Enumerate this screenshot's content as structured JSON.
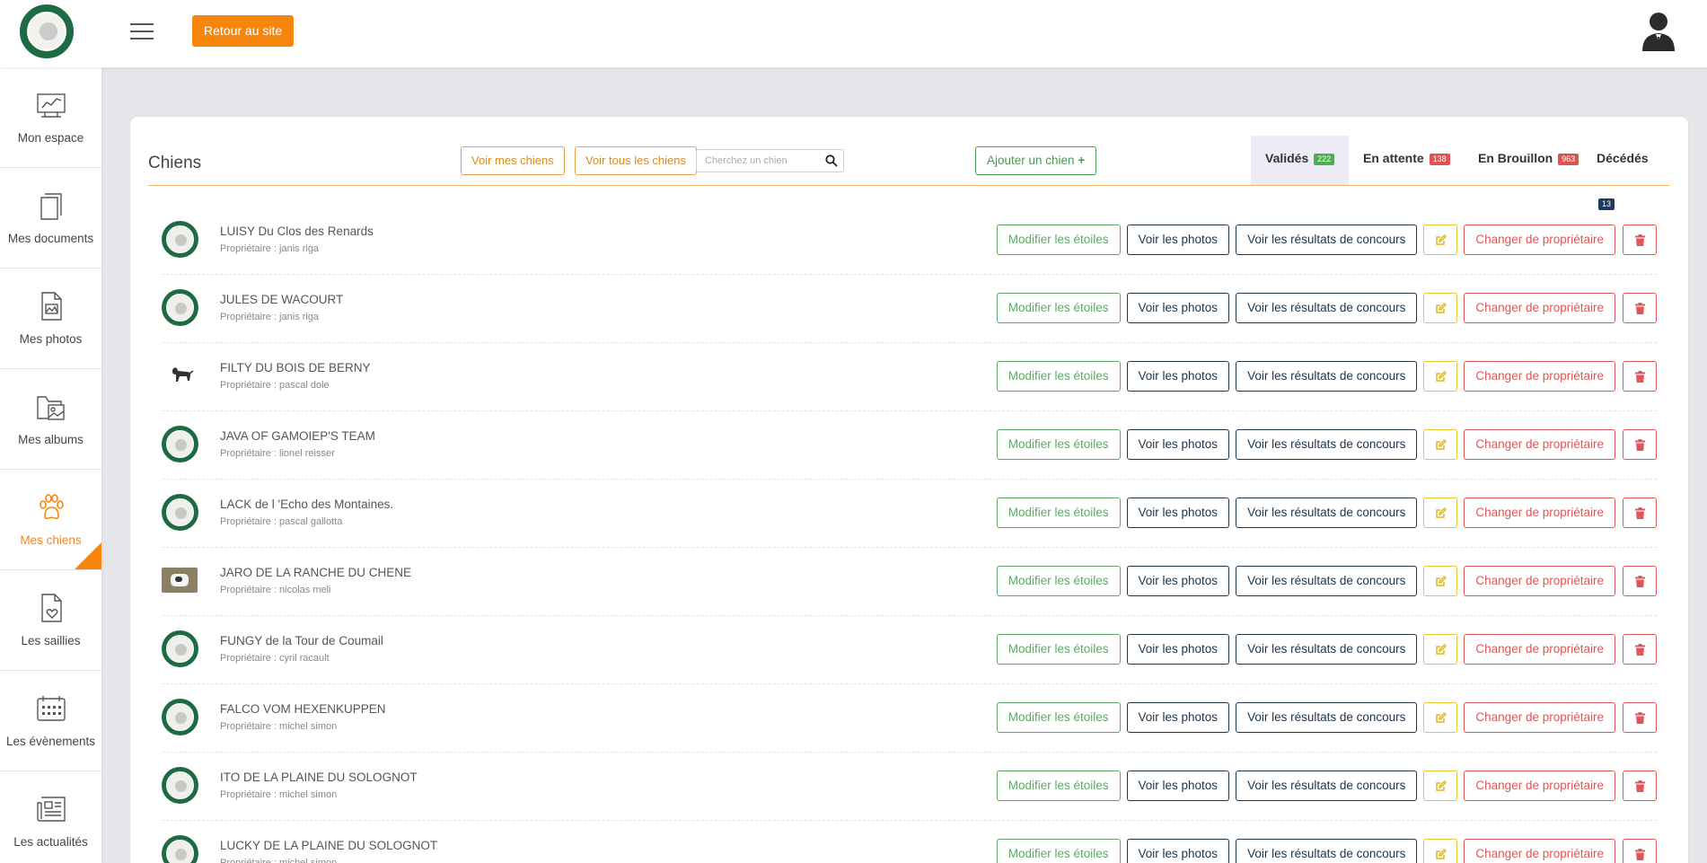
{
  "topbar": {
    "back_label": "Retour au site"
  },
  "sidebar": {
    "items": [
      {
        "label": "Mon espace",
        "icon": "dashboard-chart-icon"
      },
      {
        "label": "Mes documents",
        "icon": "documents-icon"
      },
      {
        "label": "Mes photos",
        "icon": "photo-file-icon"
      },
      {
        "label": "Mes albums",
        "icon": "album-folder-icon"
      },
      {
        "label": "Mes chiens",
        "icon": "paw-icon",
        "active": true
      },
      {
        "label": "Les saillies",
        "icon": "heart-document-icon"
      },
      {
        "label": "Les évènements",
        "icon": "calendar-icon"
      },
      {
        "label": "Les actualités",
        "icon": "newspaper-icon"
      }
    ]
  },
  "main": {
    "title": "Chiens",
    "btn_my_dogs": "Voir mes chiens",
    "btn_all_dogs": "Voir tous les chiens",
    "search_placeholder": "Cherchez un chien",
    "btn_add": "Ajouter un chien",
    "tabs": [
      {
        "label": "Validés",
        "count": "222",
        "color": "#4caf50",
        "active": true
      },
      {
        "label": "En attente",
        "count": "138",
        "color": "#e05252"
      },
      {
        "label": "En Brouillon",
        "count": "963",
        "color": "#e05252"
      },
      {
        "label": "Décédés",
        "count": "13",
        "color": "#1e3a5f"
      }
    ]
  },
  "actions": {
    "stars": "Modifier les étoiles",
    "photos": "Voir les photos",
    "results": "Voir les résultats de concours",
    "change_owner": "Changer de propriétaire"
  },
  "dogs": [
    {
      "name": "LUISY Du Clos des Renards",
      "owner": "Propriétaire : janis riga",
      "avatar": "logo"
    },
    {
      "name": "JULES DE WACOURT",
      "owner": "Propriétaire : janis riga",
      "avatar": "logo"
    },
    {
      "name": "FILTY DU BOIS DE BERNY",
      "owner": "Propriétaire : pascal dole",
      "avatar": "dog"
    },
    {
      "name": "JAVA OF GAMOIEP'S TEAM",
      "owner": "Propriétaire : lionel reisser",
      "avatar": "logo"
    },
    {
      "name": "LACK de l 'Echo des Montaines.",
      "owner": "Propriétaire : pascal gallotta",
      "avatar": "logo"
    },
    {
      "name": "JARO DE LA RANCHE DU CHENE",
      "owner": "Propriétaire : nicolas meli",
      "avatar": "photo"
    },
    {
      "name": "FUNGY de la Tour de Coumail",
      "owner": "Propriétaire : cyril racault",
      "avatar": "logo"
    },
    {
      "name": "FALCO VOM HEXENKUPPEN",
      "owner": "Propriétaire : michel simon",
      "avatar": "logo"
    },
    {
      "name": "ITO DE LA PLAINE DU SOLOGNOT",
      "owner": "Propriétaire : michel simon",
      "avatar": "logo"
    },
    {
      "name": "LUCKY DE LA PLAINE DU SOLOGNOT",
      "owner": "Propriétaire : michel simon",
      "avatar": "logo"
    }
  ]
}
